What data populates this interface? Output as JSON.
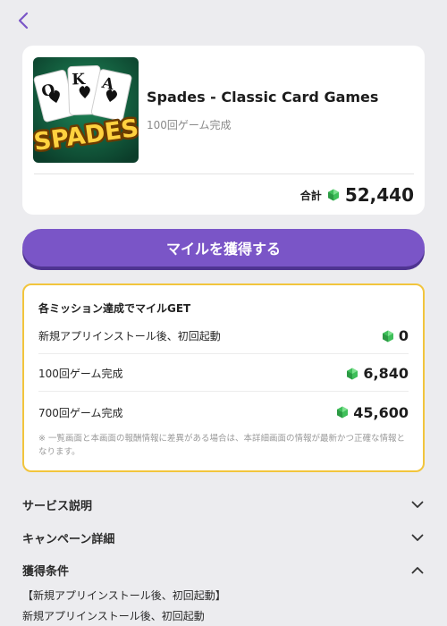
{
  "nav": {
    "back_icon": "chevron-left-icon"
  },
  "app": {
    "title": "Spades - Classic Card Games",
    "subtitle": "100回ゲーム完成",
    "thumbnail": {
      "cards": [
        "Q",
        "K",
        "A"
      ],
      "logo_text": "SPADES"
    }
  },
  "total": {
    "label": "合計",
    "value": "52,440",
    "icon": "gem-icon"
  },
  "cta": {
    "label": "マイルを獲得する"
  },
  "missions": {
    "title": "各ミッション達成でマイルGET",
    "items": [
      {
        "label": "新規アプリインストール後、初回起動",
        "value": "0"
      },
      {
        "label": "100回ゲーム完成",
        "value": "6,840"
      },
      {
        "label": "700回ゲーム完成",
        "value": "45,600"
      }
    ],
    "note": "※ 一覧画面と本画面の報酬情報に差異がある場合は、本詳細画面の情報が最新かつ正確な情報となります。"
  },
  "accordions": [
    {
      "label": "サービス説明",
      "state": "collapsed"
    },
    {
      "label": "キャンペーン詳細",
      "state": "collapsed"
    },
    {
      "label": "獲得条件",
      "state": "expanded"
    }
  ],
  "conditions": {
    "heading": "【新規アプリインストール後、初回起動】",
    "text": "新規アプリインストール後、初回起動"
  },
  "colors": {
    "accent": "#7a55c7",
    "border": "#f2c53d",
    "gem": "#3fbf5a",
    "background": "#ececef"
  }
}
